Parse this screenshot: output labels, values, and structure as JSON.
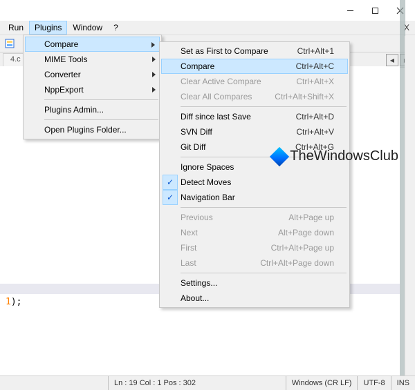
{
  "menubar": {
    "items": [
      "Run",
      "Plugins",
      "Window",
      "?"
    ],
    "open": "Plugins",
    "rightChar": "X"
  },
  "tab": {
    "label": "4.c"
  },
  "plugins_menu": {
    "items": [
      {
        "label": "Compare",
        "sub": true,
        "hi": true
      },
      {
        "label": "MIME Tools",
        "sub": true
      },
      {
        "label": "Converter",
        "sub": true
      },
      {
        "label": "NppExport",
        "sub": true
      },
      {
        "sep": true
      },
      {
        "label": "Plugins Admin..."
      },
      {
        "sep": true
      },
      {
        "label": "Open Plugins Folder..."
      }
    ]
  },
  "compare_menu": {
    "items": [
      {
        "label": "Set as First to Compare",
        "shortcut": "Ctrl+Alt+1"
      },
      {
        "label": "Compare",
        "shortcut": "Ctrl+Alt+C",
        "hi": true
      },
      {
        "label": "Clear Active Compare",
        "shortcut": "Ctrl+Alt+X",
        "dis": true
      },
      {
        "label": "Clear All Compares",
        "shortcut": "Ctrl+Alt+Shift+X",
        "dis": true
      },
      {
        "sep": true
      },
      {
        "label": "Diff since last Save",
        "shortcut": "Ctrl+Alt+D"
      },
      {
        "label": "SVN Diff",
        "shortcut": "Ctrl+Alt+V"
      },
      {
        "label": "Git Diff",
        "shortcut": "Ctrl+Alt+G"
      },
      {
        "sep": true
      },
      {
        "label": "Ignore Spaces"
      },
      {
        "label": "Detect Moves",
        "check": true
      },
      {
        "label": "Navigation Bar",
        "check": true
      },
      {
        "sep": true
      },
      {
        "label": "Previous",
        "shortcut": "Alt+Page up",
        "dis": true
      },
      {
        "label": "Next",
        "shortcut": "Alt+Page down",
        "dis": true
      },
      {
        "label": "First",
        "shortcut": "Ctrl+Alt+Page up",
        "dis": true
      },
      {
        "label": "Last",
        "shortcut": "Ctrl+Alt+Page down",
        "dis": true
      },
      {
        "sep": true
      },
      {
        "label": "Settings..."
      },
      {
        "label": "About..."
      }
    ]
  },
  "code": {
    "num": "1",
    "tail": ");"
  },
  "status": {
    "spacer_w": 140,
    "pos": "Ln : 19   Col : 1   Pos : 302",
    "eol": "Windows (CR LF)",
    "enc": "UTF-8",
    "mode": "INS"
  },
  "watermark": "TheWindowsClub"
}
